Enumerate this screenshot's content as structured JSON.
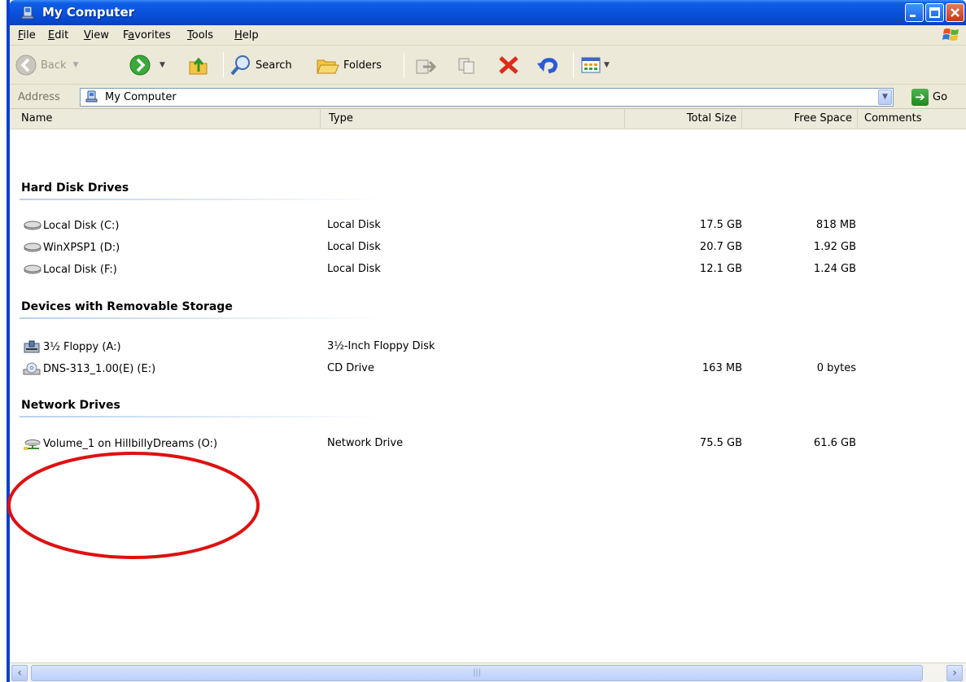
{
  "window": {
    "title": "My Computer",
    "accent_color": "#0a52dc"
  },
  "menu": {
    "items": [
      {
        "label": "File",
        "key": "F",
        "rest": "ile"
      },
      {
        "label": "Edit",
        "key": "E",
        "rest": "dit"
      },
      {
        "label": "View",
        "key": "V",
        "rest": "iew"
      },
      {
        "label": "Favorites",
        "key": "a",
        "pre": "F",
        "rest": "vorites"
      },
      {
        "label": "Tools",
        "key": "T",
        "rest": "ools"
      },
      {
        "label": "Help",
        "key": "H",
        "rest": "elp"
      }
    ]
  },
  "toolbar": {
    "back_label": "Back",
    "search_label": "Search",
    "folders_label": "Folders",
    "icons": [
      "back-arrow-icon",
      "forward-arrow-icon",
      "up-folder-icon",
      "search-magnifier-icon",
      "folders-icon",
      "move-to-icon",
      "copy-to-icon",
      "delete-x-icon",
      "undo-icon",
      "views-icon"
    ]
  },
  "address": {
    "label": "Address",
    "value": "My Computer",
    "go_label": "Go"
  },
  "columns": [
    "Name",
    "Type",
    "Total Size",
    "Free Space",
    "Comments"
  ],
  "groups": [
    {
      "title": "Hard Disk Drives",
      "rows": [
        {
          "name": "Local Disk (C:)",
          "type": "Local Disk",
          "total": "17.5 GB",
          "free": "818 MB",
          "icon": "hard-disk-icon"
        },
        {
          "name": "WinXPSP1 (D:)",
          "type": "Local Disk",
          "total": "20.7 GB",
          "free": "1.92 GB",
          "icon": "hard-disk-icon"
        },
        {
          "name": "Local Disk (F:)",
          "type": "Local Disk",
          "total": "12.1 GB",
          "free": "1.24 GB",
          "icon": "hard-disk-icon"
        }
      ]
    },
    {
      "title": "Devices with Removable Storage",
      "rows": [
        {
          "name": "3½ Floppy (A:)",
          "type": "3½-Inch Floppy Disk",
          "total": "",
          "free": "",
          "icon": "floppy-drive-icon"
        },
        {
          "name": "DNS-313_1.00(E) (E:)",
          "type": "CD Drive",
          "total": "163 MB",
          "free": "0 bytes",
          "icon": "cd-drive-icon"
        }
      ]
    },
    {
      "title": "Network Drives",
      "rows": [
        {
          "name": "Volume_1 on HillbillyDreams (O:)",
          "type": "Network Drive",
          "total": "75.5 GB",
          "free": "61.6 GB",
          "icon": "network-drive-icon"
        }
      ]
    }
  ],
  "annotation_color": "#e01010"
}
